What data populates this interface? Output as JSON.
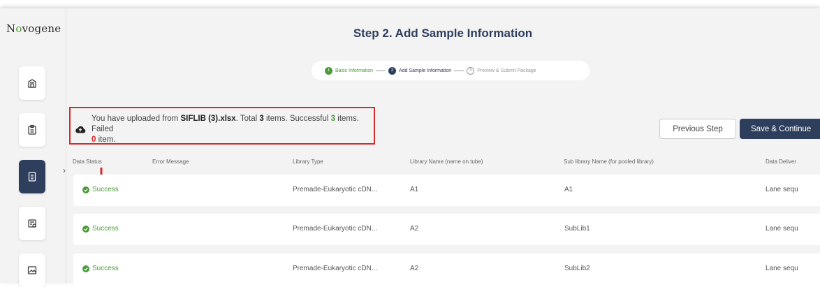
{
  "brand": {
    "logo_text": "Novogene"
  },
  "page": {
    "title": "Step 2. Add Sample Information"
  },
  "stepper": {
    "steps": [
      {
        "num": "1",
        "label": "Basic Information",
        "state": "done"
      },
      {
        "num": "2",
        "label": "Add Sample Information",
        "state": "current"
      },
      {
        "num": "3",
        "label": "Preview & Submit Package",
        "state": "todo"
      }
    ]
  },
  "upload": {
    "prefix": "You have uploaded from ",
    "filename": "SIFLIB (3).xlsx",
    "total_text": ". Total ",
    "total": "3",
    "items_successful": " items. Successful ",
    "successful": "3",
    "items_failed": " items. Failed",
    "failed": "0",
    "item_suffix": " item."
  },
  "actions": {
    "previous_label": "Previous Step",
    "save_label": "Save & Continue"
  },
  "table": {
    "columns": [
      "Data Status",
      "Error Message",
      "Library Type",
      "Library Name (name on tube)",
      "Sub library Name (for pooled library)",
      "Data Deliver"
    ],
    "rows": [
      {
        "status": "Success",
        "error": "",
        "library_type": "Premade-Eukaryotic cDN...",
        "library_name": "A1",
        "sub_library": "A1",
        "delivery": "Lane sequ"
      },
      {
        "status": "Success",
        "error": "",
        "library_type": "Premade-Eukaryotic cDN...",
        "library_name": "A2",
        "sub_library": "SubLib1",
        "delivery": "Lane sequ"
      },
      {
        "status": "Success",
        "error": "",
        "library_type": "Premade-Eukaryotic cDN...",
        "library_name": "A2",
        "sub_library": "SubLib2",
        "delivery": "Lane sequ"
      }
    ]
  },
  "colors": {
    "navy": "#2e3f5e",
    "success_green": "#4a9a3a",
    "highlight_red": "#d52b2b"
  },
  "icons": {
    "sidebar": [
      "building-icon",
      "clipboard-icon",
      "document-icon",
      "package-icon",
      "image-icon"
    ],
    "upload": "cloud-upload-icon",
    "status": "check-circle-icon",
    "annotation": "red-arrow-icon"
  }
}
